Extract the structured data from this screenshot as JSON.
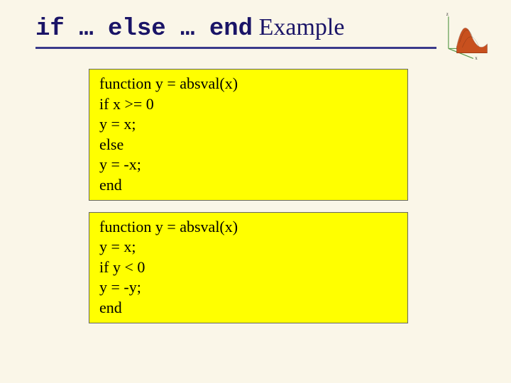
{
  "title": {
    "part1": "if",
    "dots1": " … ",
    "part2": "else",
    "dots2": " … ",
    "part3": "end",
    "suffix": " Example"
  },
  "code_block_1": {
    "lines": [
      "function y = absval(x)",
      "if x >= 0",
      "y = x;",
      "else",
      "y = -x;",
      "end"
    ]
  },
  "code_block_2": {
    "lines": [
      "function y = absval(x)",
      "y = x;",
      "if y < 0",
      "y = -y;",
      "end"
    ]
  },
  "logo_name": "matlab-logo"
}
